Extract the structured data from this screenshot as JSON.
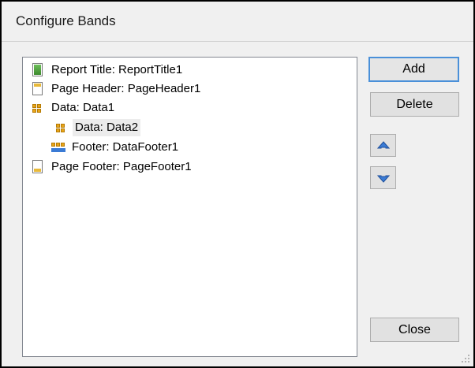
{
  "window": {
    "title": "Configure Bands"
  },
  "bands": [
    {
      "label": "Report Title: ReportTitle1",
      "icon": "report-title-band-icon",
      "level": 0
    },
    {
      "label": "Page Header: PageHeader1",
      "icon": "page-header-band-icon",
      "level": 0
    },
    {
      "label": "Data: Data1",
      "icon": "data-band-icon",
      "level": 0
    },
    {
      "label": "Data: Data2",
      "icon": "data-band-icon",
      "level": 1,
      "selected": true
    },
    {
      "label": "Footer: DataFooter1",
      "icon": "data-footer-band-icon",
      "level": 1
    },
    {
      "label": "Page Footer: PageFooter1",
      "icon": "page-footer-band-icon",
      "level": 0
    }
  ],
  "buttons": {
    "add": "Add",
    "delete": "Delete",
    "close": "Close",
    "move_up_icon": "arrow-up-icon",
    "move_down_icon": "arrow-down-icon"
  },
  "colors": {
    "dialog_bg": "#f0f0f0",
    "default_button_border": "#4a90d9",
    "arrow_blue": "#3a7bd5"
  }
}
